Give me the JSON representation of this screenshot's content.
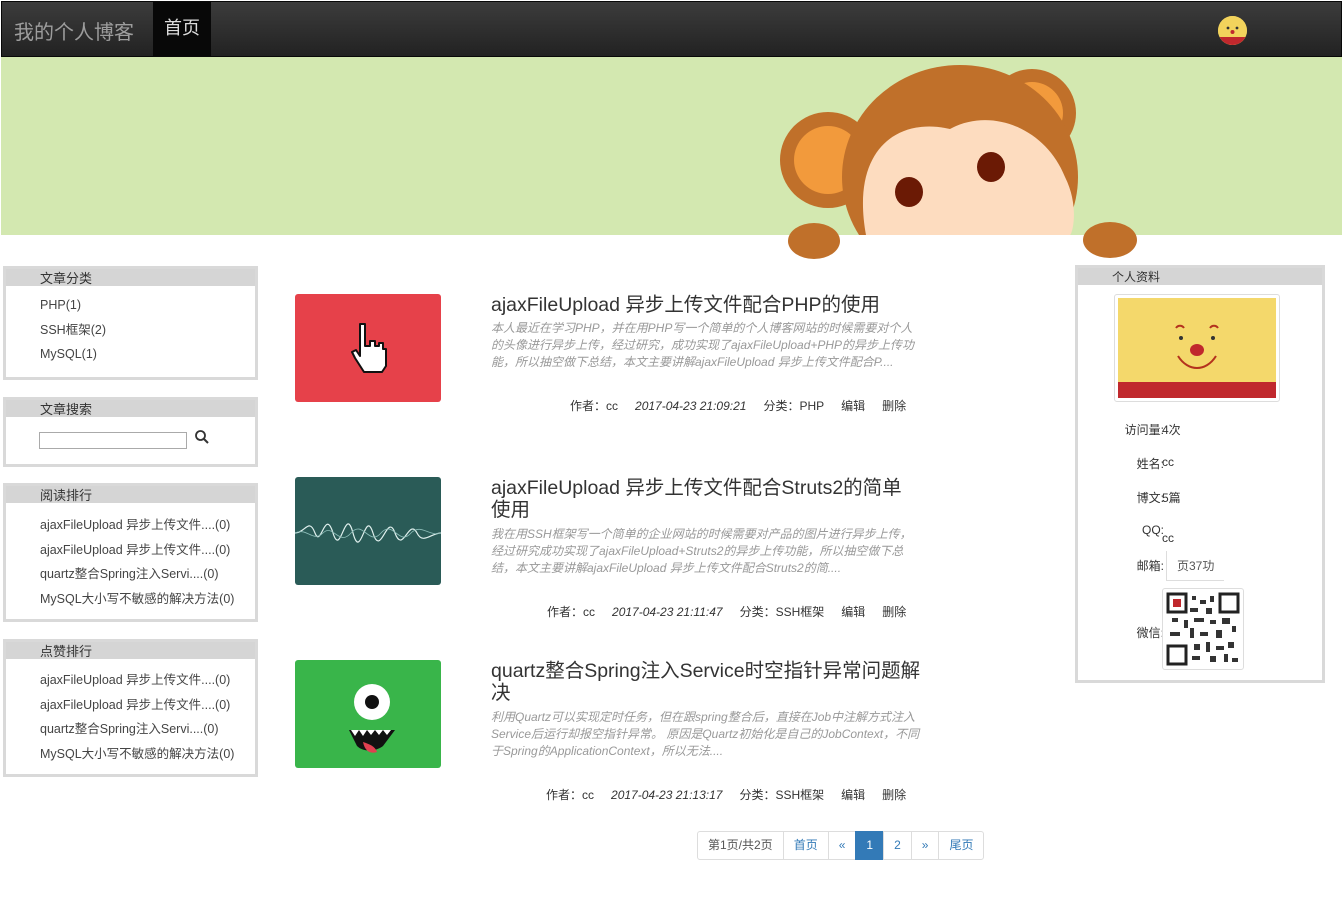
{
  "navbar": {
    "brand": "我的个人博客",
    "home": "首页"
  },
  "sidebar": {
    "categories": {
      "title": "文章分类",
      "items": [
        "PHP(1)",
        "SSH框架(2)",
        "MySQL(1)"
      ]
    },
    "search": {
      "title": "文章搜索",
      "placeholder": ""
    },
    "read_rank": {
      "title": "阅读排行",
      "items": [
        "ajaxFileUpload 异步上传文件....(0)",
        "ajaxFileUpload 异步上传文件....(0)",
        "quartz整合Spring注入Servi....(0)",
        "MySQL大小写不敏感的解决方法(0)"
      ]
    },
    "like_rank": {
      "title": "点赞排行",
      "items": [
        "ajaxFileUpload 异步上传文件....(0)",
        "ajaxFileUpload 异步上传文件....(0)",
        "quartz整合Spring注入Servi....(0)",
        "MySQL大小写不敏感的解决方法(0)"
      ]
    }
  },
  "articles": [
    {
      "title": "ajaxFileUpload 异步上传文件配合PHP的使用",
      "summary": "本人最近在学习PHP，并在用PHP写一个简单的个人博客网站的时候需要对个人的头像进行异步上传，经过研究，成功实现了ajaxFileUpload+PHP的异步上传功能，所以抽空做下总结，本文主要讲解ajaxFileUpload 异步上传文件配合P....",
      "author": "作者：cc",
      "date": "2017-04-23 21:09:21",
      "category": "分类：PHP",
      "edit": "编辑",
      "delete": "删除",
      "thumb_color": "#e6414a"
    },
    {
      "title": "ajaxFileUpload 异步上传文件配合Struts2的简单使用",
      "summary": "我在用SSH框架写一个简单的企业网站的时候需要对产品的图片进行异步上传，经过研究成功实现了ajaxFileUpload+Struts2的异步上传功能，所以抽空做下总结，本文主要讲解ajaxFileUpload 异步上传文件配合Struts2的简....",
      "author": "作者：cc",
      "date": "2017-04-23 21:11:47",
      "category": "分类：SSH框架",
      "edit": "编辑",
      "delete": "删除",
      "thumb_color": "#2a5b57"
    },
    {
      "title": "quartz整合Spring注入Service时空指针异常问题解决",
      "summary": "利用Quartz可以实现定时任务，但在跟spring整合后，直接在Job中注解方式注入Service后运行却报空指针异常。 原因是Quartz初始化是自己的JobContext，不同于Spring的ApplicationContext，所以无法....",
      "author": "作者：cc",
      "date": "2017-04-23 21:13:17",
      "category": "分类：SSH框架",
      "edit": "编辑",
      "delete": "删除",
      "thumb_color": "#39b54a"
    }
  ],
  "pagination": {
    "info": "第1页/共2页",
    "first": "首页",
    "prev": "«",
    "current": "1",
    "next_page": "2",
    "next": "»",
    "last": "尾页"
  },
  "profile": {
    "title": "个人资料",
    "visits_label": "访问量:",
    "visits": "4次",
    "name_label": "姓名:",
    "name": "cc",
    "posts_label": "博文:",
    "posts": "5篇",
    "qq_label": "QQ:",
    "qq": "cc",
    "email_label": "邮箱:",
    "email": "页37功",
    "wechat_label": "微信:"
  },
  "colors": {
    "banner": "#d3e8b0",
    "navbar": "#222222",
    "primary": "#337ab7"
  }
}
